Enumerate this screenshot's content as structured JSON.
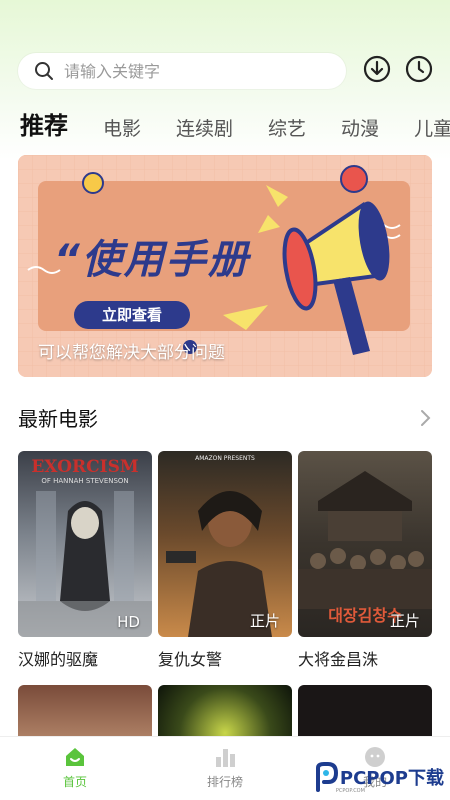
{
  "search": {
    "placeholder": "请输入关键字"
  },
  "header": {
    "download_icon": "download-icon",
    "history_icon": "clock-icon"
  },
  "tabs": [
    "推荐",
    "电影",
    "连续剧",
    "综艺",
    "动漫",
    "儿童"
  ],
  "banner": {
    "headline": "“使用手册",
    "button_label": "立即查看",
    "caption": "可以帮您解决大部分问题"
  },
  "section": {
    "title": "最新电影",
    "more_icon": "chevron-right-icon"
  },
  "movies": [
    {
      "title": "汉娜的驱魔",
      "badge": "HD",
      "poster_text": "EXORCISM",
      "poster_sub": "OF HANNAH STEVENSON"
    },
    {
      "title": "复仇女警",
      "badge": "正片",
      "poster_text": "AMAZON PRESENTS"
    },
    {
      "title": "大将金昌洙",
      "badge": "正片"
    }
  ],
  "nav": [
    {
      "label": "首页",
      "icon": "home-icon"
    },
    {
      "label": "排行榜",
      "icon": "chart-icon"
    },
    {
      "label": "我的",
      "icon": "user-icon"
    }
  ],
  "watermark": {
    "text": "PCPOP下载",
    "sub": "PCPOP.COM"
  },
  "colors": {
    "accent": "#5ac43c",
    "banner_bg": "#f6c9b4",
    "banner_panel": "#e8a07c",
    "banner_button": "#2d3a8c"
  }
}
